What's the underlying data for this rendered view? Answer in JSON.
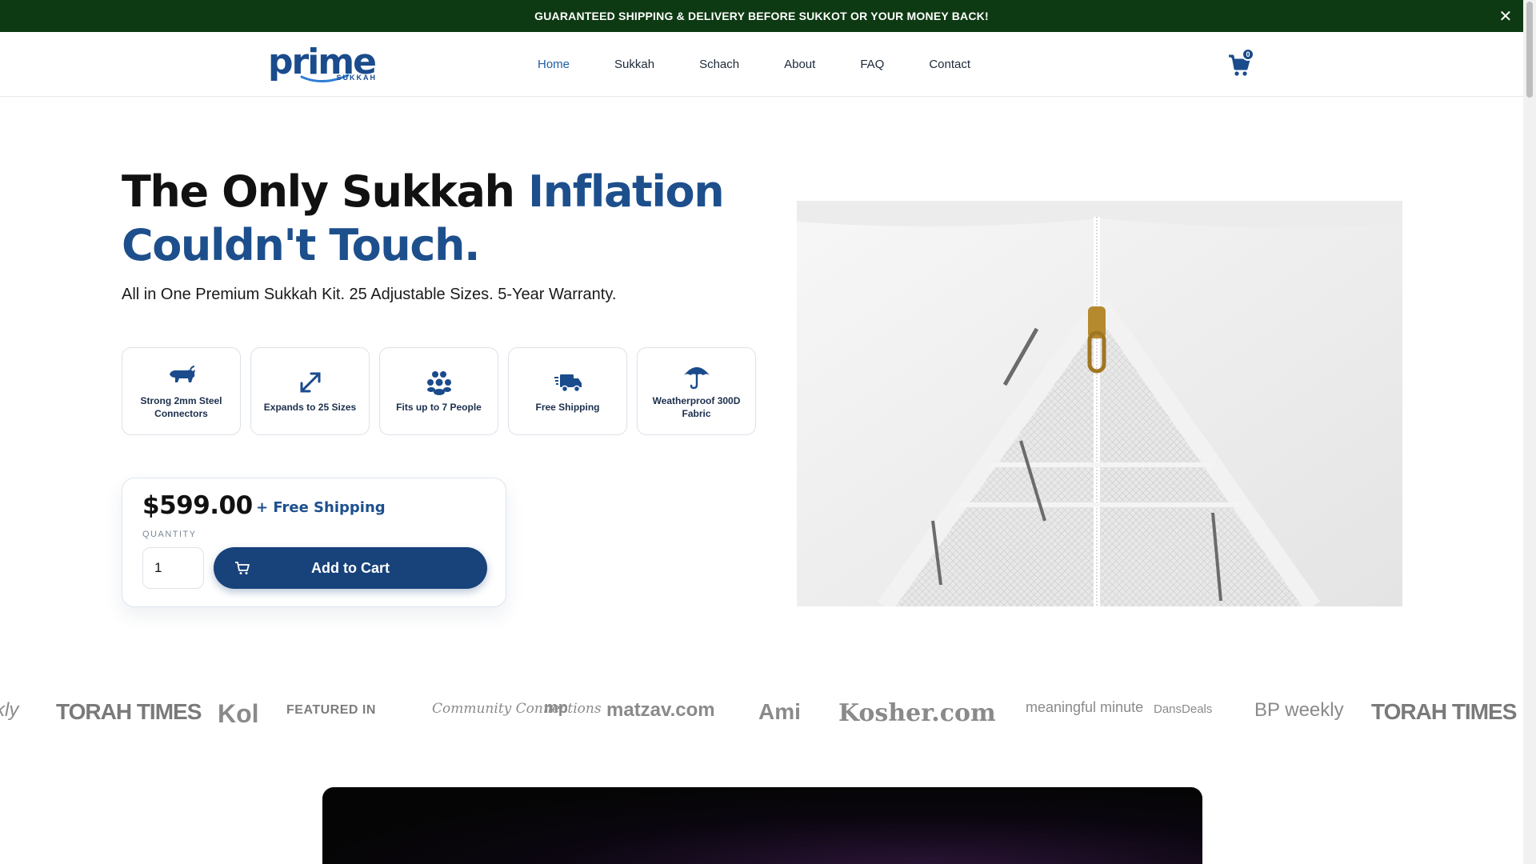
{
  "announcement": {
    "text": "GUARANTEED SHIPPING & DELIVERY BEFORE SUKKOT OR YOUR MONEY BACK!",
    "close_glyph": "✕"
  },
  "header": {
    "logo_word": "prime",
    "logo_sub": "SUKKAH",
    "nav": [
      "Home",
      "Sukkah",
      "Schach",
      "About",
      "FAQ",
      "Contact"
    ],
    "active_nav": "Home",
    "cart_count": "0"
  },
  "hero": {
    "title_part1": "The Only Sukkah ",
    "title_accent": "Inflation Couldn't Touch.",
    "subtitle": "All in One Premium Sukkah Kit. 25 Adjustable Sizes. 5-Year Warranty.",
    "features": [
      {
        "label": "Strong 2mm Steel Connectors",
        "icon": "bull-icon"
      },
      {
        "label": "Expands to 25 Sizes",
        "icon": "expand-arrows-icon"
      },
      {
        "label": "Fits up to 7 People",
        "icon": "people-group-icon"
      },
      {
        "label": "Free Shipping",
        "icon": "delivery-truck-icon"
      },
      {
        "label": "Weatherproof 300D Fabric",
        "icon": "umbrella-icon"
      }
    ]
  },
  "buybox": {
    "price": "$599.00",
    "shipping": "+ Free Shipping",
    "quantity_label": "QUANTITY",
    "quantity_value": "1",
    "add_to_cart": "Add to Cart"
  },
  "featured": {
    "label": "FEATURED IN",
    "logos": [
      "kly",
      "TORAH TIMES",
      "Kol",
      "Community Connections",
      "mp",
      "matzav.com",
      "Ami",
      "Kosher.com",
      "meaningful minute",
      "DansDeals",
      "BP weekly",
      "TORAH TIMES"
    ]
  },
  "colors": {
    "brand": "#1a4b8c",
    "announce_bg": "#0e3a13",
    "button": "#17427a"
  }
}
